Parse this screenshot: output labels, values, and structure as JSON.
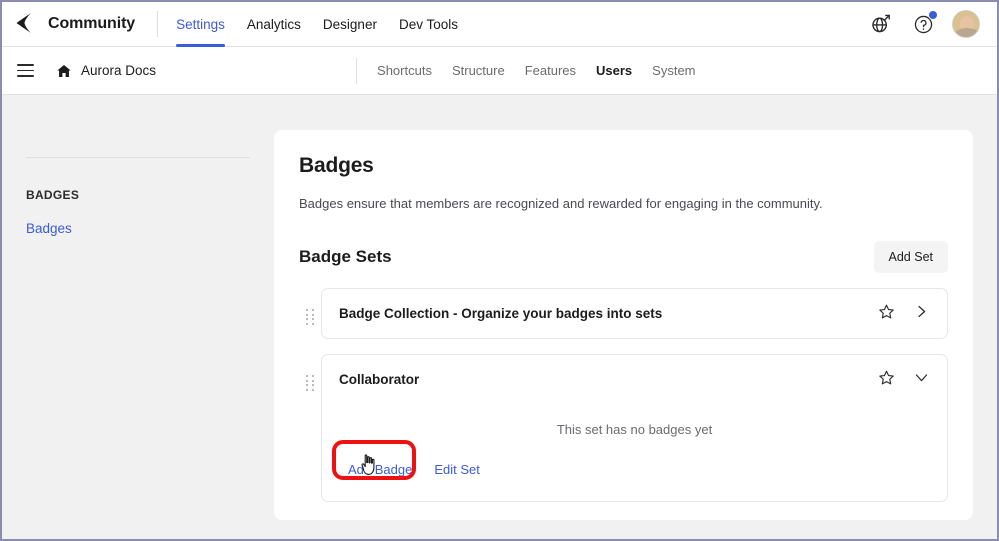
{
  "topbar": {
    "logo_icon": "logo-glyph-icon",
    "brand": "Community",
    "nav": [
      {
        "label": "Settings",
        "active": true
      },
      {
        "label": "Analytics",
        "active": false
      },
      {
        "label": "Designer",
        "active": false
      },
      {
        "label": "Dev Tools",
        "active": false
      }
    ],
    "actions": {
      "globe_icon": "globe-external-link-icon",
      "help_icon": "help-question-icon",
      "help_badge": "notification-dot",
      "avatar": "user-avatar"
    }
  },
  "subbar": {
    "menu_icon": "hamburger-menu-icon",
    "home_icon": "home-icon",
    "site_name": "Aurora Docs",
    "nav": [
      {
        "label": "Shortcuts",
        "active": false
      },
      {
        "label": "Structure",
        "active": false
      },
      {
        "label": "Features",
        "active": false
      },
      {
        "label": "Users",
        "active": true
      },
      {
        "label": "System",
        "active": false
      }
    ]
  },
  "sidebar": {
    "section_label": "BADGES",
    "items": [
      {
        "label": "Badges"
      }
    ]
  },
  "main": {
    "title": "Badges",
    "description": "Badges ensure that members are recognized and rewarded for engaging in the community.",
    "sets_title": "Badge Sets",
    "add_set_label": "Add Set",
    "sets": [
      {
        "name": "Badge Collection - Organize your badges into sets",
        "star_icon": "star-outline-icon",
        "toggle_icon": "chevron-right-icon",
        "expanded": false
      },
      {
        "name": "Collaborator",
        "star_icon": "star-outline-icon",
        "toggle_icon": "chevron-down-icon",
        "expanded": true,
        "empty_message": "This set has no badges yet",
        "add_badge_label": "Add Badge",
        "edit_set_label": "Edit Set"
      }
    ]
  },
  "annotation": {
    "target": "Add Badge",
    "highlight_color": "#ee1111",
    "cursor": "pointer-hand-cursor"
  },
  "colors": {
    "accent": "#3b5bdb",
    "page_bg": "#f1f1f1",
    "card_bg": "#ffffff",
    "text": "#1c1c1e",
    "muted": "#6b6b70"
  }
}
